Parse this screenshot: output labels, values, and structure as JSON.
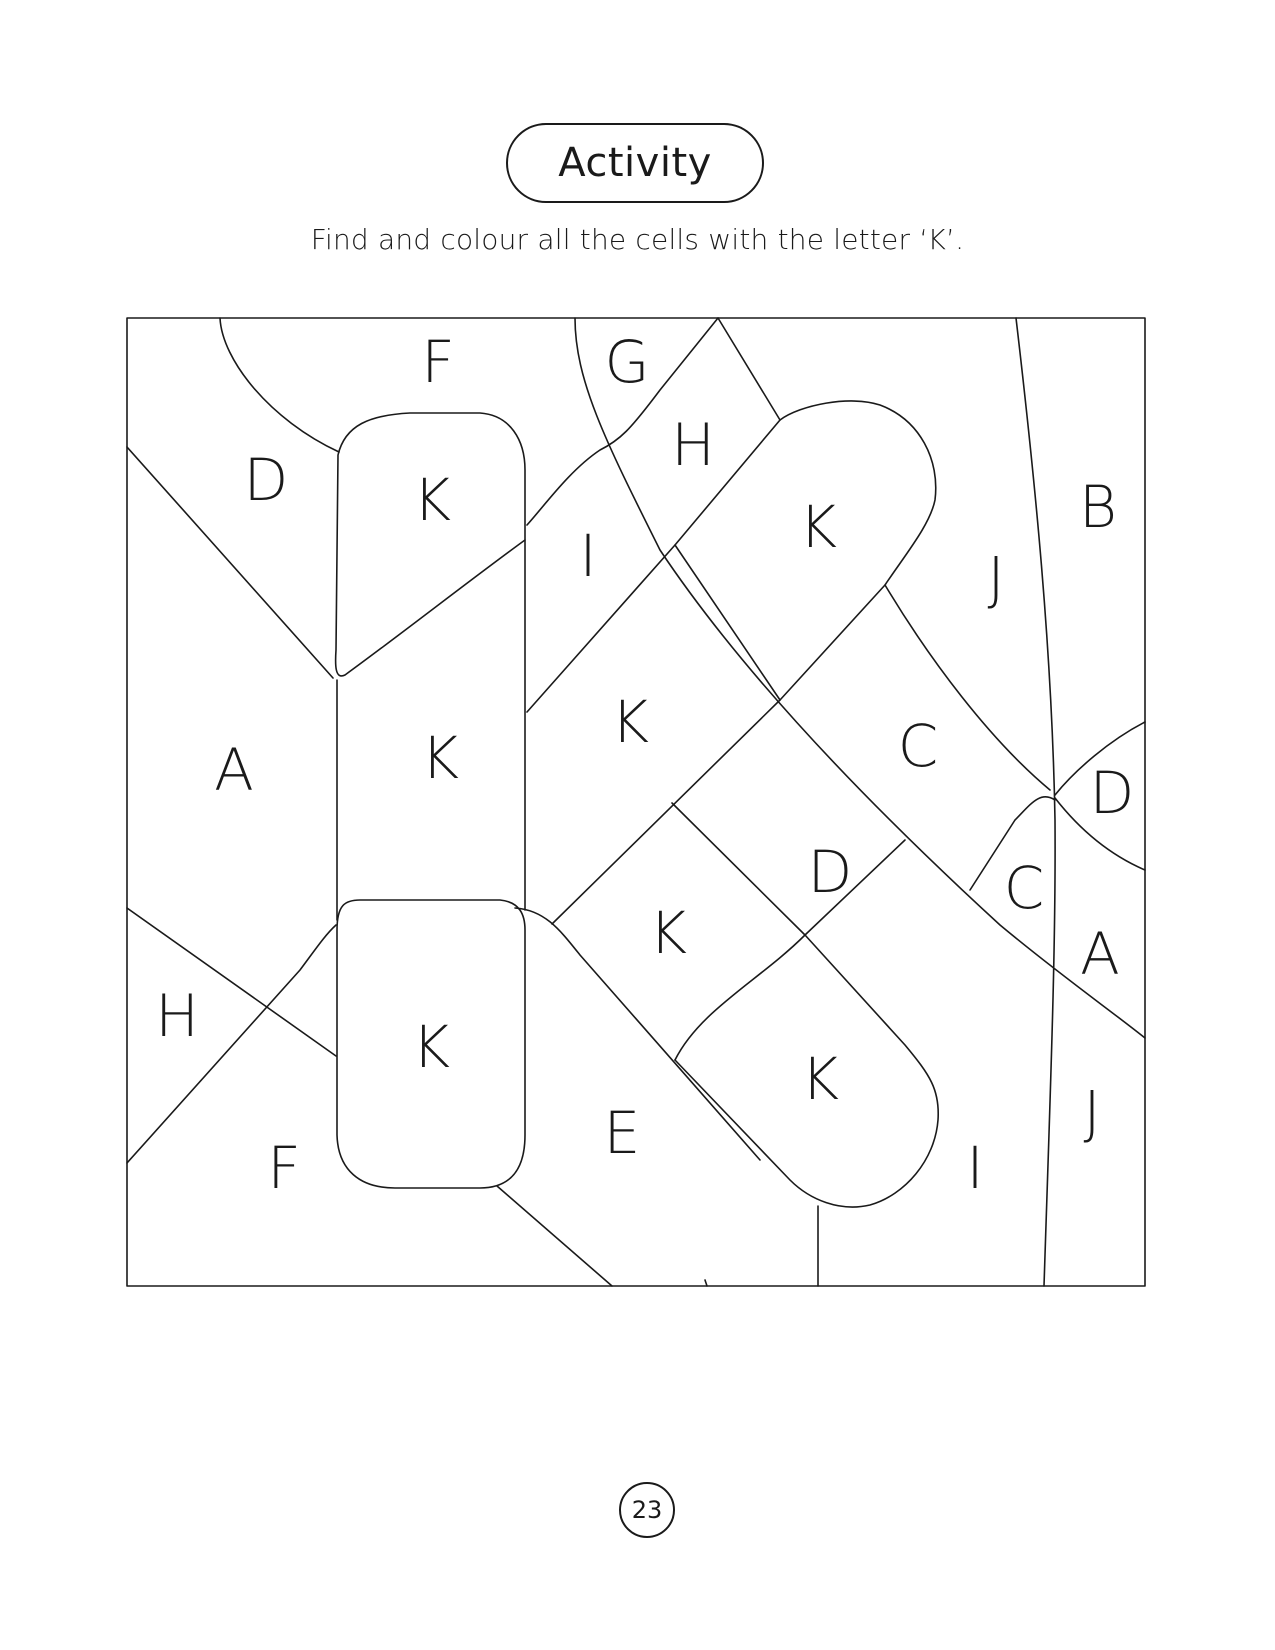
{
  "header": {
    "title": "Activity",
    "instruction": "Find and colour all the cells with the letter ‘K’."
  },
  "puzzle": {
    "target_letter": "K",
    "cell_letters": [
      "F",
      "G",
      "D",
      "K",
      "H",
      "I",
      "K",
      "B",
      "J",
      "A",
      "K",
      "K",
      "C",
      "D",
      "D",
      "C",
      "K",
      "A",
      "H",
      "K",
      "E",
      "K",
      "J",
      "F",
      "I"
    ]
  },
  "footer": {
    "page_number": "23"
  }
}
